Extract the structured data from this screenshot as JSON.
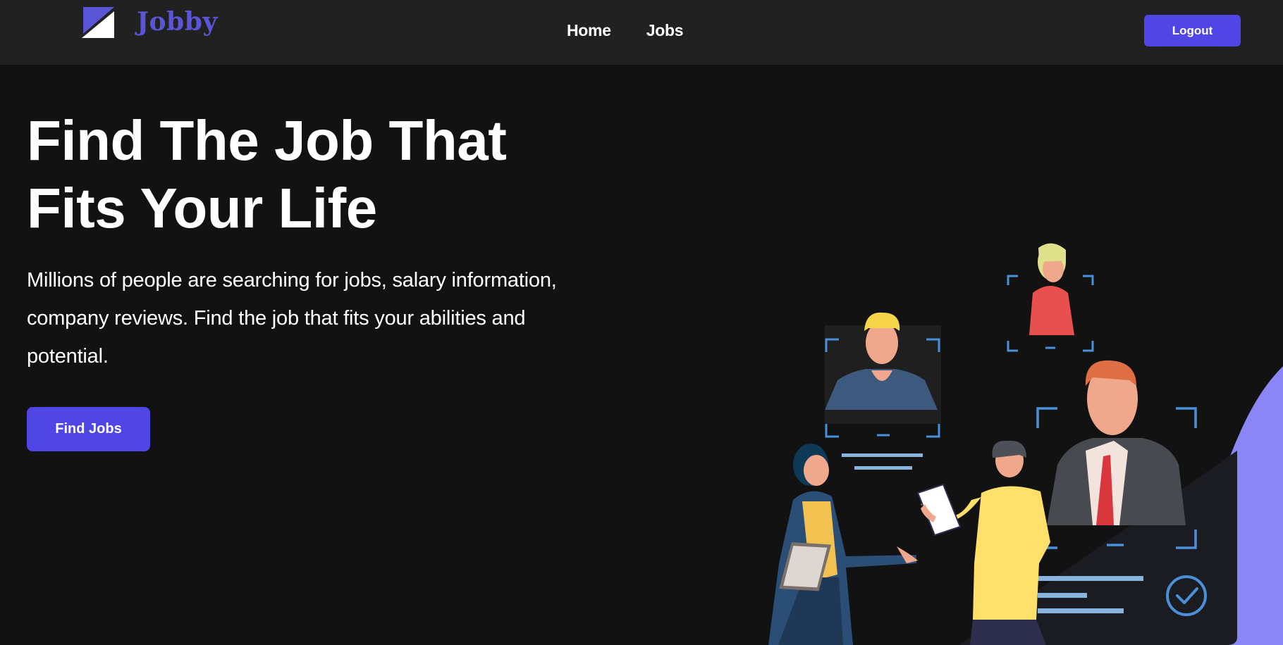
{
  "header": {
    "logo_text": "Jobby",
    "nav": [
      {
        "label": "Home"
      },
      {
        "label": "Jobs"
      }
    ],
    "logout_label": "Logout"
  },
  "hero": {
    "title_line1": "Find The Job That",
    "title_line2": "Fits Your Life",
    "description": "Millions of people are searching for jobs, salary information, company reviews. Find the job that fits your abilities and potential.",
    "cta_label": "Find Jobs"
  },
  "colors": {
    "accent": "#4f46e5",
    "header_bg": "#212121",
    "page_bg": "#121212",
    "logo_text": "#5a55d6"
  }
}
